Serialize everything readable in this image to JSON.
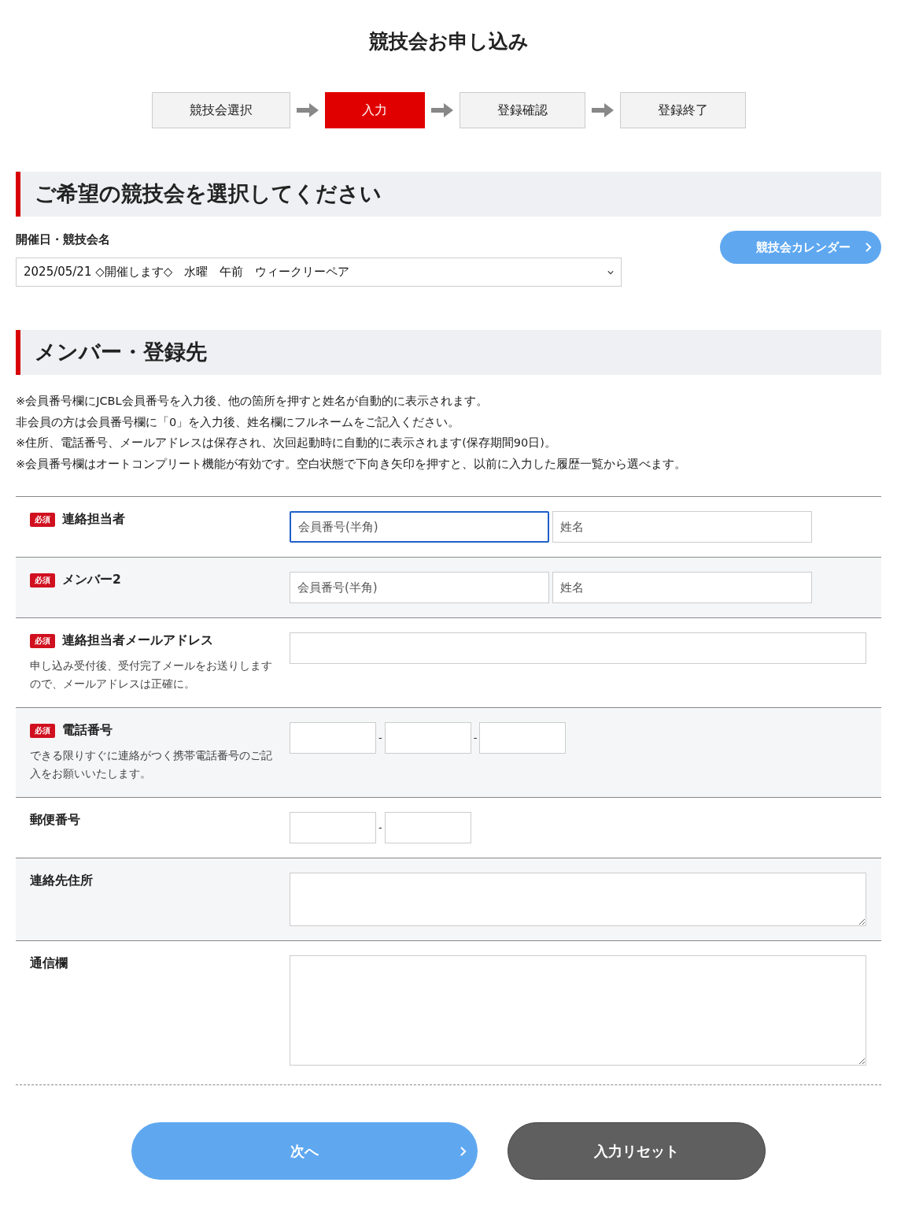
{
  "page_title": "競技会お申し込み",
  "steps": [
    {
      "label": "競技会選択",
      "selected": false
    },
    {
      "label": "入力",
      "selected": true
    },
    {
      "label": "登録確認",
      "selected": false
    },
    {
      "label": "登録終了",
      "selected": false
    }
  ],
  "event_section": {
    "heading": "ご希望の競技会を選択してください",
    "field_label": "開催日・競技会名",
    "calendar_button": "競技会カレンダー",
    "select_value": "2025/05/21 ◇開催します◇　水曜　午前　ウィークリーペア"
  },
  "member_section": {
    "heading": "メンバー・登録先",
    "notes": [
      "※会員番号欄にJCBL会員番号を入力後、他の箇所を押すと姓名が自動的に表示されます。",
      "非会員の方は会員番号欄に「0」を入力後、姓名欄にフルネームをご記入ください。",
      "※住所、電話番号、メールアドレスは保存され、次回起動時に自動的に表示されます(保存期間90日)。",
      "※会員番号欄はオートコンプリート機能が有効です。空白状態で下向き矢印を押すと、以前に入力した履歴一覧から選べます。"
    ]
  },
  "form_rows": [
    {
      "label": "連絡担当者",
      "badge": "必須",
      "kind": "name_pair",
      "fields": [
        {
          "placeholder": "会員番号(半角)",
          "focused": true
        },
        {
          "placeholder": "姓名",
          "focused": false
        }
      ]
    },
    {
      "label": "メンバー2",
      "badge": "必須",
      "kind": "name_pair",
      "fields": [
        {
          "placeholder": "会員番号(半角)",
          "focused": false
        },
        {
          "placeholder": "姓名",
          "focused": false
        }
      ]
    },
    {
      "label": "連絡担当者メールアドレス",
      "badge": "必須",
      "kind": "wide_input",
      "note": "申し込み受付後、受付完了メールをお送りしますので、メールアドレスは正確に。"
    },
    {
      "label": "電話番号",
      "badge": "必須",
      "kind": "split_input",
      "separators": [
        "-",
        "-"
      ],
      "note": "できる限りすぐに連絡がつく携帯電話番号のご記入をお願いいたします。"
    },
    {
      "label": "郵便番号",
      "kind": "split_input",
      "separators": [
        "-"
      ]
    },
    {
      "label": "連絡先住所",
      "kind": "short_textarea"
    },
    {
      "label": "通信欄",
      "kind": "tall_textarea"
    }
  ],
  "buttons": [
    {
      "label": "次へ",
      "kind": "primary"
    },
    {
      "label": "入力リセット",
      "kind": "secondary"
    }
  ]
}
